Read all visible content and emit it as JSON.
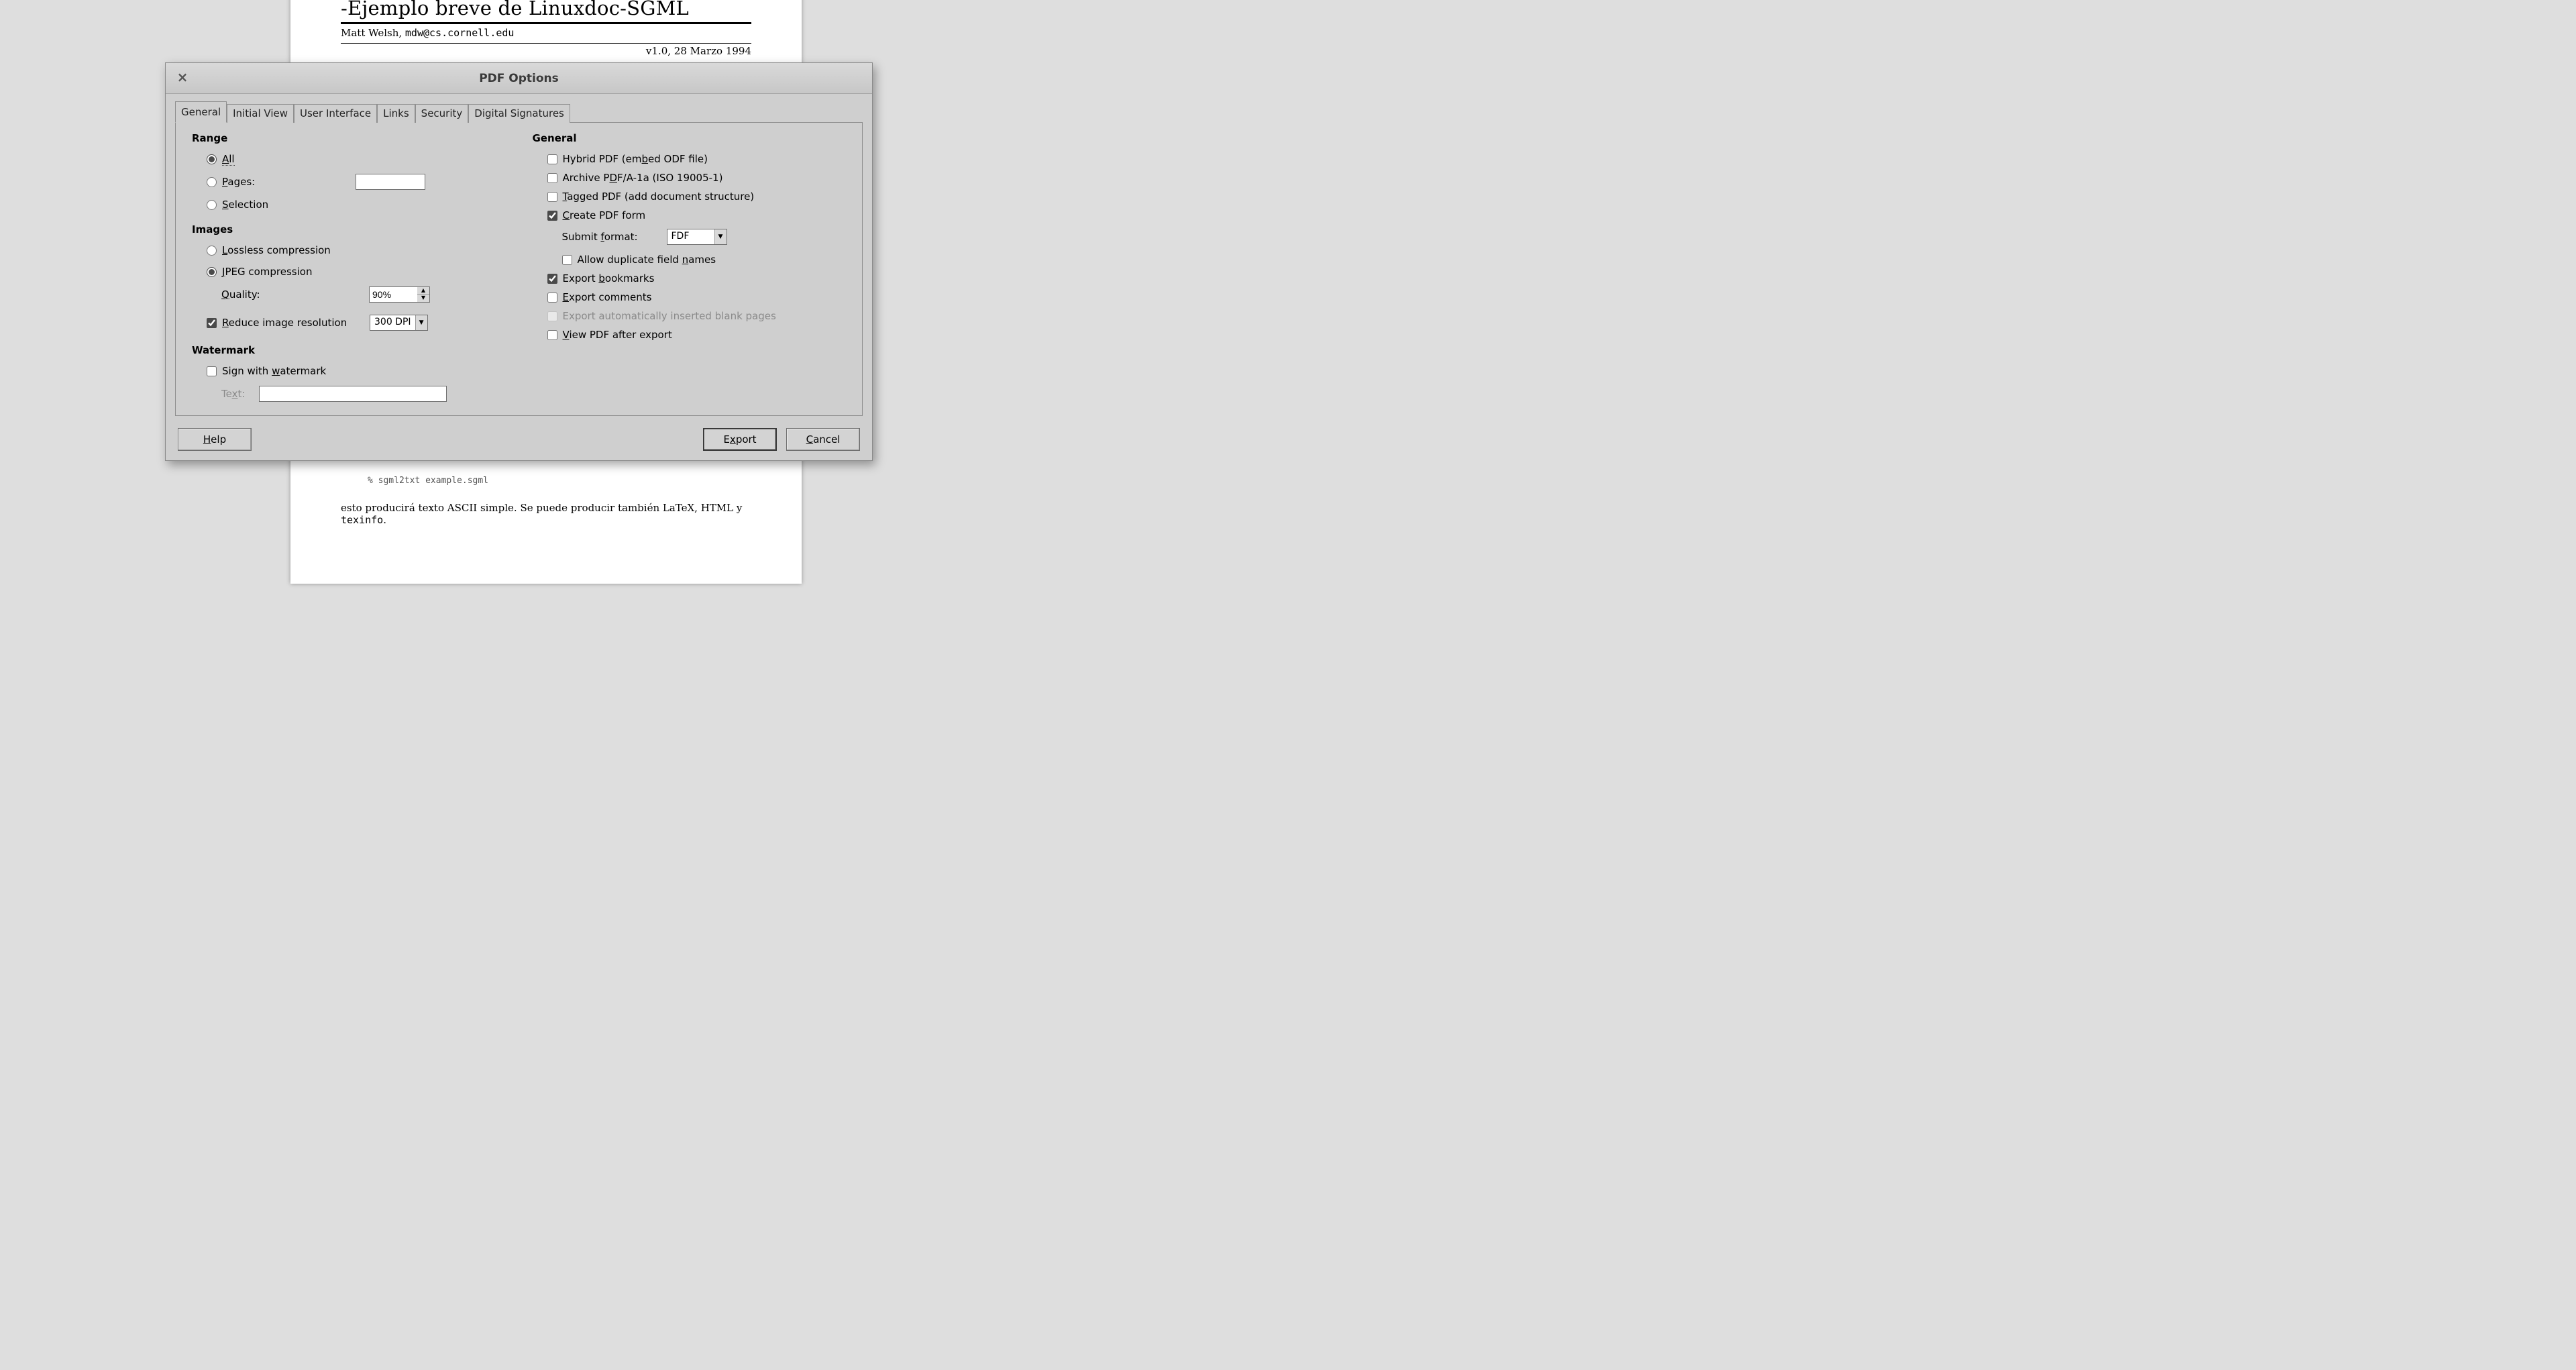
{
  "document": {
    "title": "-Ejemplo breve de Linuxdoc-SGML",
    "author_name": "Matt Welsh,",
    "author_email": "mdw@cs.cornell.edu",
    "version_date": "v1.0, 28 Marzo 1994",
    "code_line": "% sgml2txt example.sgml",
    "body_pre": "esto producirá texto ASCII simple. Se puede producir también LaTeX, HTML y ",
    "body_mono": "texinfo",
    "body_post": "."
  },
  "dialog": {
    "title": "PDF Options",
    "tabs": [
      "General",
      "Initial View",
      "User Interface",
      "Links",
      "Security",
      "Digital Signatures"
    ],
    "active_tab": 0,
    "left": {
      "range": {
        "heading": "Range",
        "all": "All",
        "pages": "Pages:",
        "pages_value": "",
        "selection": "Selection",
        "selected": "all"
      },
      "images": {
        "heading": "Images",
        "lossless": "Lossless compression",
        "jpeg": "JPEG compression",
        "selected": "jpeg",
        "quality_label": "Quality:",
        "quality_value": "90%",
        "reduce": "Reduce image resolution",
        "reduce_checked": true,
        "dpi_value": "300 DPI"
      },
      "watermark": {
        "heading": "Watermark",
        "sign": "Sign with watermark",
        "sign_checked": false,
        "text_label": "Text:",
        "text_value": ""
      }
    },
    "right": {
      "heading": "General",
      "hybrid": {
        "label": "Hybrid PDF (embed ODF file)",
        "checked": false
      },
      "archive": {
        "label": "Archive PDF/A-1a (ISO 19005-1)",
        "checked": false
      },
      "tagged": {
        "label": "Tagged PDF (add document structure)",
        "checked": false
      },
      "create_form": {
        "label": "Create PDF form",
        "checked": true
      },
      "submit_format_label": "Submit format:",
      "submit_format_value": "FDF",
      "dup_fields": {
        "label": "Allow duplicate field names",
        "checked": false
      },
      "bookmarks": {
        "label": "Export bookmarks",
        "checked": true
      },
      "comments": {
        "label": "Export comments",
        "checked": false
      },
      "blank_pages": {
        "label": "Export automatically inserted blank pages",
        "checked": false,
        "disabled": true
      },
      "view_after": {
        "label": "View PDF after export",
        "checked": false
      }
    },
    "buttons": {
      "help": "Help",
      "export": "Export",
      "cancel": "Cancel"
    }
  }
}
